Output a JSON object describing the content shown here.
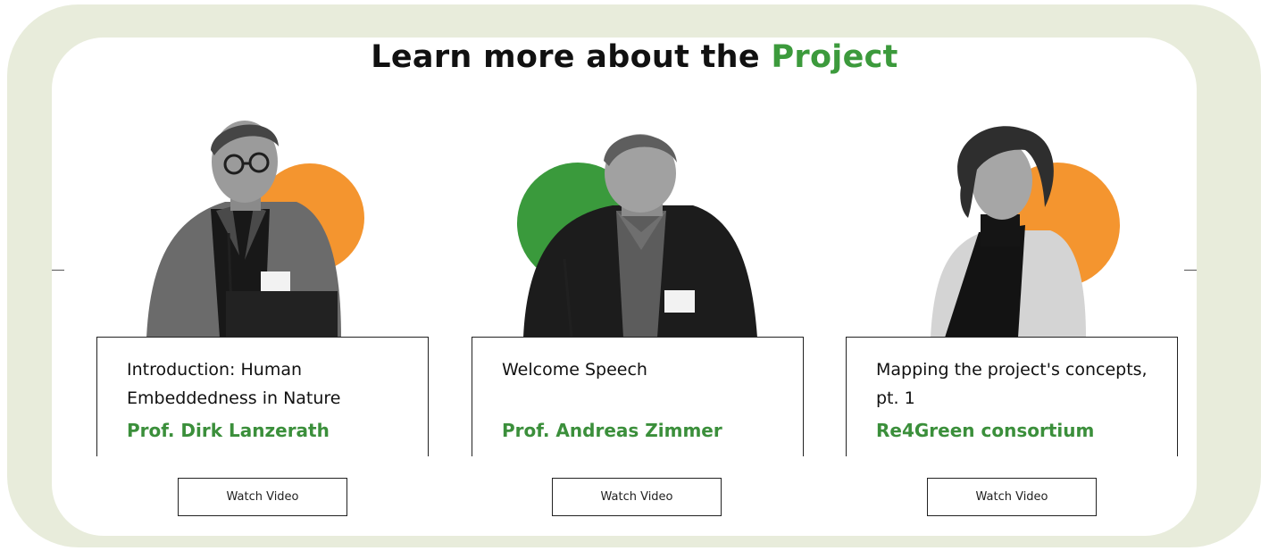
{
  "section": {
    "heading_prefix": "Learn more about the",
    "heading_accent": "Project"
  },
  "colors": {
    "accent_green": "#3c9a3c",
    "circle_orange": "#f4952f",
    "circle_green": "#3a9a3c",
    "frame_bg": "#e8ecdb"
  },
  "videos": [
    {
      "title": "Introduction: Human Embeddedness in Nature",
      "author": "Prof. Dirk Lanzerath",
      "button_label": "Watch Video",
      "portrait_icon": "speaker-portrait-icon",
      "accent_circle": "orange"
    },
    {
      "title": "Welcome Speech",
      "author": "Prof. Andreas Zimmer",
      "button_label": "Watch Video",
      "portrait_icon": "speaker-portrait-icon",
      "accent_circle": "green"
    },
    {
      "title": "Mapping the project's concepts, pt. 1",
      "author": "Re4Green consortium",
      "button_label": "Watch Video",
      "portrait_icon": "speaker-portrait-icon",
      "accent_circle": "orange"
    }
  ]
}
